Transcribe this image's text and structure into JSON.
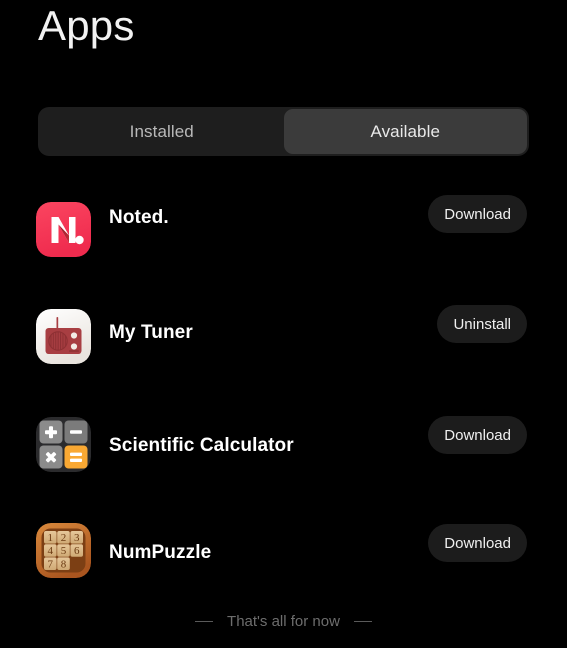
{
  "header": {
    "title": "Apps"
  },
  "tabs": {
    "items": [
      {
        "label": "Installed",
        "active": false
      },
      {
        "label": "Available",
        "active": true
      }
    ]
  },
  "apps": [
    {
      "name": "Noted.",
      "icon": "noted-app-icon",
      "action": "Download"
    },
    {
      "name": "My Tuner",
      "icon": "mytuner-app-icon",
      "action": "Uninstall"
    },
    {
      "name": "Scientific Calculator",
      "icon": "calculator-app-icon",
      "action": "Download"
    },
    {
      "name": "NumPuzzle",
      "icon": "numpuzzle-app-icon",
      "action": "Download"
    }
  ],
  "footer": {
    "text": "That's all for now",
    "dash": "—"
  },
  "colors": {
    "background": "#000000",
    "tab_bar": "#1e1e1e",
    "tab_active": "#3b3b3b",
    "button": "#1c1c1c",
    "text_primary": "#ffffff",
    "text_muted": "#6d6d6d",
    "noted_pink": "#f63a55",
    "tuner_red": "#a83e42",
    "calc_orange": "#f9a833",
    "puzzle_wood": "#c8732a"
  },
  "puzzle": {
    "tiles": [
      "1",
      "2",
      "3",
      "4",
      "5",
      "6",
      "7",
      "8",
      ""
    ]
  },
  "calculator": {
    "keys": [
      "+",
      "−",
      "×",
      "="
    ]
  }
}
